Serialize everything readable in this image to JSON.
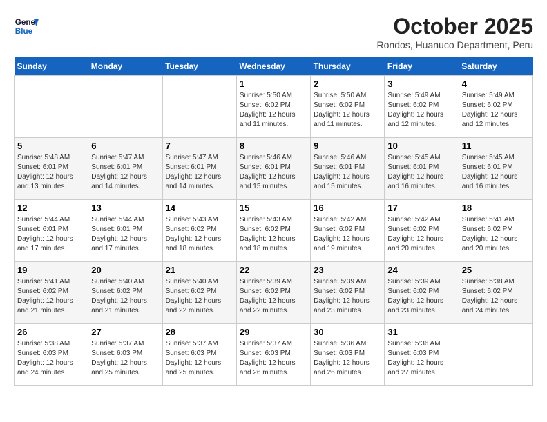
{
  "header": {
    "logo_line1": "General",
    "logo_line2": "Blue",
    "month": "October 2025",
    "location": "Rondos, Huanuco Department, Peru"
  },
  "weekdays": [
    "Sunday",
    "Monday",
    "Tuesday",
    "Wednesday",
    "Thursday",
    "Friday",
    "Saturday"
  ],
  "weeks": [
    [
      {
        "day": "",
        "info": ""
      },
      {
        "day": "",
        "info": ""
      },
      {
        "day": "",
        "info": ""
      },
      {
        "day": "1",
        "info": "Sunrise: 5:50 AM\nSunset: 6:02 PM\nDaylight: 12 hours\nand 11 minutes."
      },
      {
        "day": "2",
        "info": "Sunrise: 5:50 AM\nSunset: 6:02 PM\nDaylight: 12 hours\nand 11 minutes."
      },
      {
        "day": "3",
        "info": "Sunrise: 5:49 AM\nSunset: 6:02 PM\nDaylight: 12 hours\nand 12 minutes."
      },
      {
        "day": "4",
        "info": "Sunrise: 5:49 AM\nSunset: 6:02 PM\nDaylight: 12 hours\nand 12 minutes."
      }
    ],
    [
      {
        "day": "5",
        "info": "Sunrise: 5:48 AM\nSunset: 6:01 PM\nDaylight: 12 hours\nand 13 minutes."
      },
      {
        "day": "6",
        "info": "Sunrise: 5:47 AM\nSunset: 6:01 PM\nDaylight: 12 hours\nand 14 minutes."
      },
      {
        "day": "7",
        "info": "Sunrise: 5:47 AM\nSunset: 6:01 PM\nDaylight: 12 hours\nand 14 minutes."
      },
      {
        "day": "8",
        "info": "Sunrise: 5:46 AM\nSunset: 6:01 PM\nDaylight: 12 hours\nand 15 minutes."
      },
      {
        "day": "9",
        "info": "Sunrise: 5:46 AM\nSunset: 6:01 PM\nDaylight: 12 hours\nand 15 minutes."
      },
      {
        "day": "10",
        "info": "Sunrise: 5:45 AM\nSunset: 6:01 PM\nDaylight: 12 hours\nand 16 minutes."
      },
      {
        "day": "11",
        "info": "Sunrise: 5:45 AM\nSunset: 6:01 PM\nDaylight: 12 hours\nand 16 minutes."
      }
    ],
    [
      {
        "day": "12",
        "info": "Sunrise: 5:44 AM\nSunset: 6:01 PM\nDaylight: 12 hours\nand 17 minutes."
      },
      {
        "day": "13",
        "info": "Sunrise: 5:44 AM\nSunset: 6:01 PM\nDaylight: 12 hours\nand 17 minutes."
      },
      {
        "day": "14",
        "info": "Sunrise: 5:43 AM\nSunset: 6:02 PM\nDaylight: 12 hours\nand 18 minutes."
      },
      {
        "day": "15",
        "info": "Sunrise: 5:43 AM\nSunset: 6:02 PM\nDaylight: 12 hours\nand 18 minutes."
      },
      {
        "day": "16",
        "info": "Sunrise: 5:42 AM\nSunset: 6:02 PM\nDaylight: 12 hours\nand 19 minutes."
      },
      {
        "day": "17",
        "info": "Sunrise: 5:42 AM\nSunset: 6:02 PM\nDaylight: 12 hours\nand 20 minutes."
      },
      {
        "day": "18",
        "info": "Sunrise: 5:41 AM\nSunset: 6:02 PM\nDaylight: 12 hours\nand 20 minutes."
      }
    ],
    [
      {
        "day": "19",
        "info": "Sunrise: 5:41 AM\nSunset: 6:02 PM\nDaylight: 12 hours\nand 21 minutes."
      },
      {
        "day": "20",
        "info": "Sunrise: 5:40 AM\nSunset: 6:02 PM\nDaylight: 12 hours\nand 21 minutes."
      },
      {
        "day": "21",
        "info": "Sunrise: 5:40 AM\nSunset: 6:02 PM\nDaylight: 12 hours\nand 22 minutes."
      },
      {
        "day": "22",
        "info": "Sunrise: 5:39 AM\nSunset: 6:02 PM\nDaylight: 12 hours\nand 22 minutes."
      },
      {
        "day": "23",
        "info": "Sunrise: 5:39 AM\nSunset: 6:02 PM\nDaylight: 12 hours\nand 23 minutes."
      },
      {
        "day": "24",
        "info": "Sunrise: 5:39 AM\nSunset: 6:02 PM\nDaylight: 12 hours\nand 23 minutes."
      },
      {
        "day": "25",
        "info": "Sunrise: 5:38 AM\nSunset: 6:02 PM\nDaylight: 12 hours\nand 24 minutes."
      }
    ],
    [
      {
        "day": "26",
        "info": "Sunrise: 5:38 AM\nSunset: 6:03 PM\nDaylight: 12 hours\nand 24 minutes."
      },
      {
        "day": "27",
        "info": "Sunrise: 5:37 AM\nSunset: 6:03 PM\nDaylight: 12 hours\nand 25 minutes."
      },
      {
        "day": "28",
        "info": "Sunrise: 5:37 AM\nSunset: 6:03 PM\nDaylight: 12 hours\nand 25 minutes."
      },
      {
        "day": "29",
        "info": "Sunrise: 5:37 AM\nSunset: 6:03 PM\nDaylight: 12 hours\nand 26 minutes."
      },
      {
        "day": "30",
        "info": "Sunrise: 5:36 AM\nSunset: 6:03 PM\nDaylight: 12 hours\nand 26 minutes."
      },
      {
        "day": "31",
        "info": "Sunrise: 5:36 AM\nSunset: 6:03 PM\nDaylight: 12 hours\nand 27 minutes."
      },
      {
        "day": "",
        "info": ""
      }
    ]
  ]
}
